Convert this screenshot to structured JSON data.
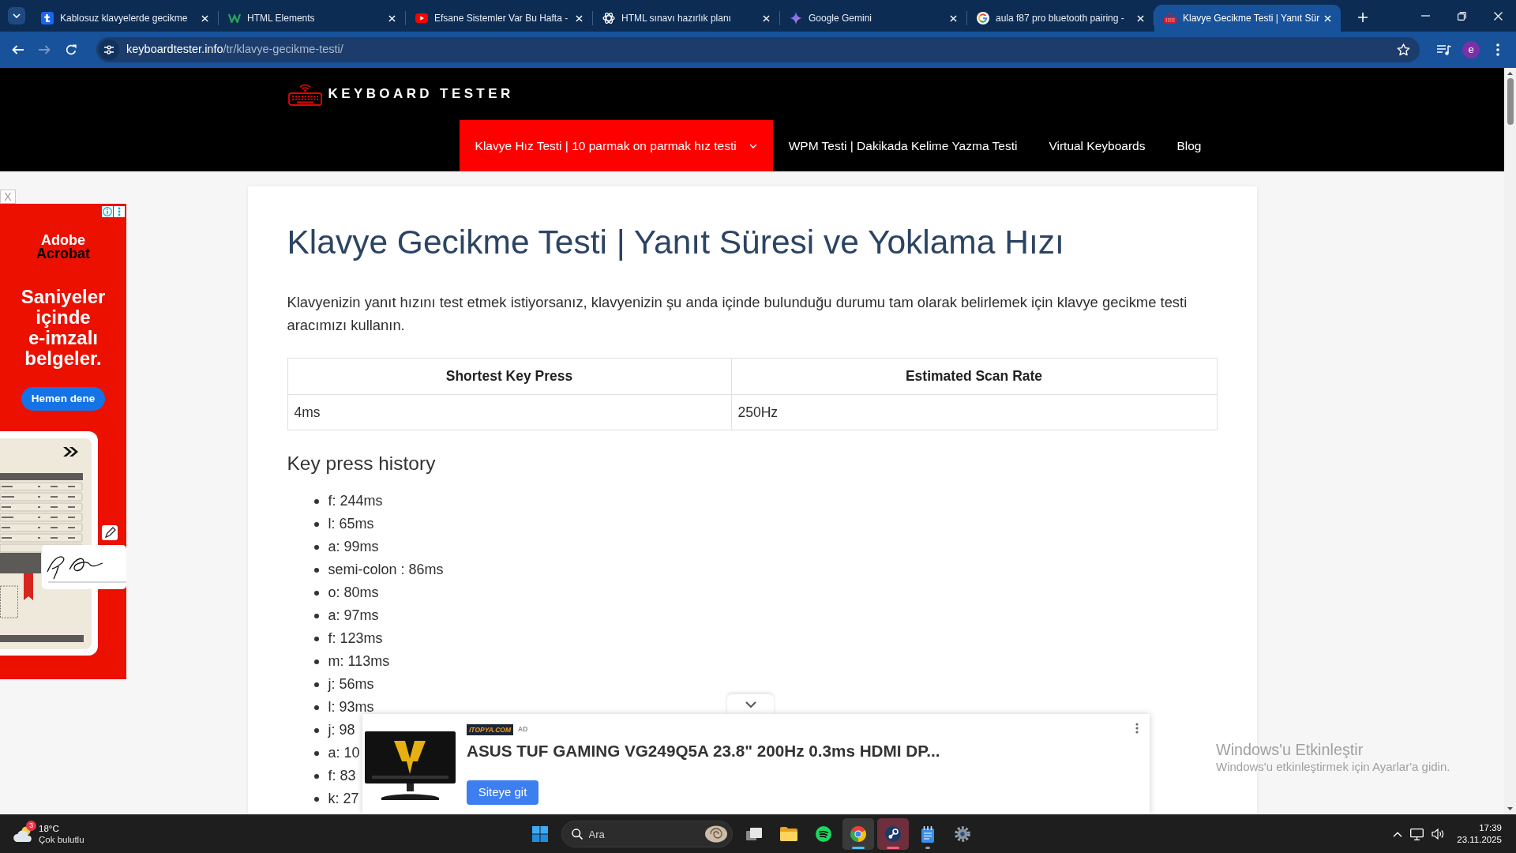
{
  "browser": {
    "tabs": [
      {
        "kind": "tile",
        "title": "Kablosuz klavyelerde gecikme",
        "selected": false
      },
      {
        "kind": "wmark",
        "title": "HTML Elements",
        "selected": false
      },
      {
        "kind": "play",
        "title": "Efsane Sistemler Var Bu Hafta -",
        "selected": false
      },
      {
        "kind": "knot",
        "title": "HTML sınavı hazırlık planı",
        "selected": false
      },
      {
        "kind": "sparkle",
        "title": "Google Gemini",
        "selected": false
      },
      {
        "kind": "ring",
        "title": "aula f87 pro bluetooth pairing -",
        "selected": false
      },
      {
        "kind": "keyboard",
        "title": "Klavye Gecikme Testi | Yanıt Sür",
        "selected": true
      }
    ],
    "forward_disabled": true,
    "address": {
      "host": "keyboardtester.info",
      "path": "/tr/klavye-gecikme-testi/"
    },
    "profile": "e"
  },
  "site": {
    "logo": "KEYBOARD TESTER",
    "menu": [
      {
        "label": "Klavye Hız Testi | 10 parmak on parmak hız testi",
        "selected": true,
        "dropdown": true
      },
      {
        "label": "WPM Testi | Dakikada Kelime Yazma Testi",
        "selected": false,
        "dropdown": false
      },
      {
        "label": "Virtual Keyboards",
        "selected": false,
        "dropdown": false
      },
      {
        "label": "Blog",
        "selected": false,
        "dropdown": false
      }
    ]
  },
  "article": {
    "title": "Klavye Gecikme Testi | Yanıt Süresi ve Yoklama Hızı",
    "intro": "Klavyenizin yanıt hızını test etmek istiyorsanız, klavyenizin şu anda içinde bulunduğu durumu tam olarak belirlemek için klavye gecikme testi aracımızı kullanın.",
    "table": {
      "columns": [
        "Shortest Key Press",
        "Estimated Scan Rate"
      ],
      "rows": [
        [
          "4ms",
          "250Hz"
        ]
      ]
    },
    "history": {
      "title": "Key press history",
      "items": [
        "f: 244ms",
        "l: 65ms",
        "a: 99ms",
        "semi-colon : 86ms",
        "o: 80ms",
        "a: 97ms",
        "f: 123ms",
        "m: 113ms",
        "j: 56ms",
        "l: 93ms",
        "j: 98",
        "a: 10",
        "f: 83",
        "k: 27"
      ]
    }
  },
  "side_ad": {
    "close": "X",
    "brand": [
      "Adobe",
      "Acrobat"
    ],
    "headline": "Saniyeler içinde e-imzalı belgeler.",
    "button": "Hemen dene"
  },
  "bottom_ad": {
    "advertiser": "ITOPYA.COM",
    "label": "AD",
    "title": "ASUS TUF GAMING VG249Q5A 23.8\" 200Hz 0.3ms HDMI DP...",
    "button": "Siteye git"
  },
  "activation_notice": {
    "title": "Windows'u Etkinleştir",
    "text": "Windows'u etkinleştirmek için Ayarlar'a gidin."
  },
  "taskbar": {
    "weather": {
      "badge": "3",
      "temperature": "18°C",
      "condition": "Çok bulutlu"
    },
    "search": {
      "placeholder": "Ara"
    },
    "apps": [
      {
        "kind": "taskview",
        "running": false,
        "active": false,
        "attention": false
      },
      {
        "kind": "folder",
        "running": false,
        "active": false,
        "attention": false
      },
      {
        "kind": "waves",
        "running": false,
        "active": false,
        "attention": false
      },
      {
        "kind": "ring",
        "running": true,
        "active": true,
        "attention": false
      },
      {
        "kind": "emblem",
        "running": true,
        "active": false,
        "attention": true
      },
      {
        "kind": "notepad",
        "running": true,
        "active": false,
        "attention": false
      },
      {
        "kind": "gear",
        "running": false,
        "active": false,
        "attention": false
      }
    ],
    "clock": {
      "time": "17:39",
      "date": "23.11.2025"
    }
  }
}
